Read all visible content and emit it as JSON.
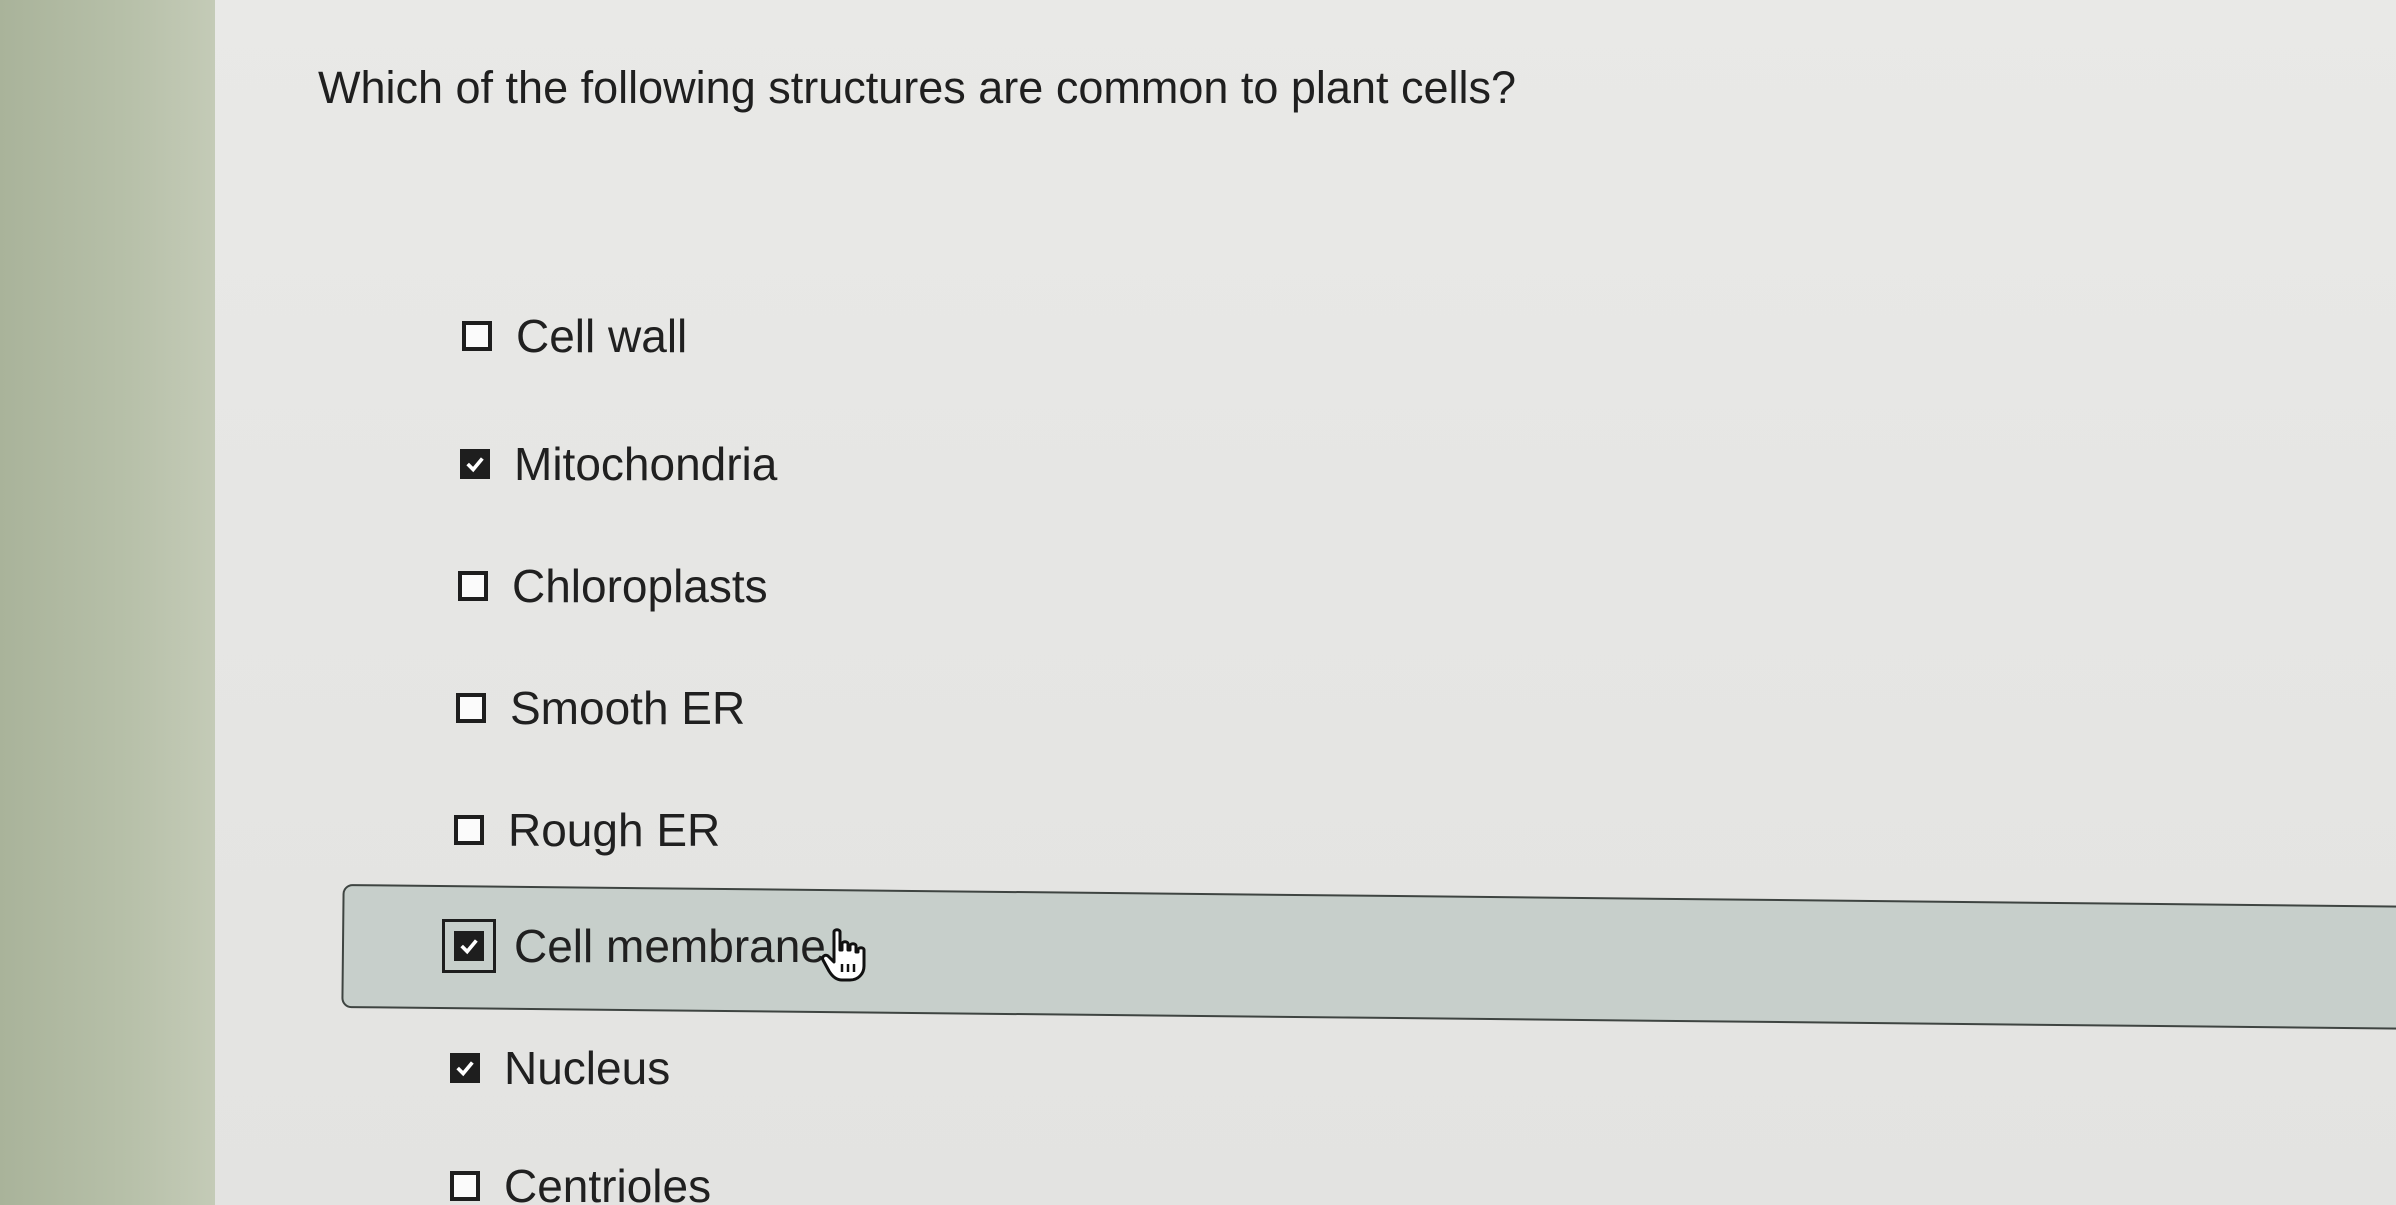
{
  "question": "Which of the following structures are common to plant cells?",
  "options": [
    {
      "label": "Cell wall",
      "checked": false
    },
    {
      "label": "Mitochondria",
      "checked": true
    },
    {
      "label": "Chloroplasts",
      "checked": false
    },
    {
      "label": "Smooth ER",
      "checked": false
    },
    {
      "label": "Rough ER",
      "checked": false
    },
    {
      "label": "Cell membrane",
      "checked": true,
      "hovered": true
    },
    {
      "label": "Nucleus",
      "checked": true
    },
    {
      "label": "Centrioles",
      "checked": false
    }
  ],
  "icons": {
    "checkmark": "checkmark-icon",
    "cursor": "hand-pointer-icon"
  },
  "colors": {
    "hover_row": "#c7cfcb",
    "checkbox": "#1e1e1e"
  }
}
